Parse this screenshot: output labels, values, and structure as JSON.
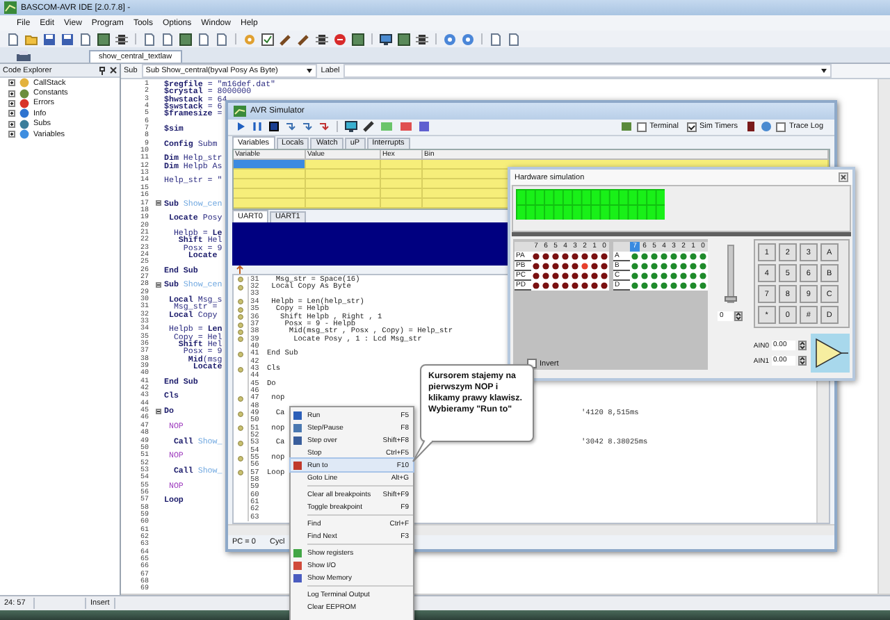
{
  "window": {
    "title": "BASCOM-AVR IDE [2.0.7.8] -"
  },
  "menu": [
    "File",
    "Edit",
    "View",
    "Program",
    "Tools",
    "Options",
    "Window",
    "Help"
  ],
  "file_tab": {
    "label": "show_central_textlaw",
    "selected": true
  },
  "code_explorer": {
    "title": "Code Explorer",
    "items": [
      {
        "label": "CallStack",
        "expanded": false
      },
      {
        "label": "Constants",
        "expanded": false
      },
      {
        "label": "Errors",
        "expanded": false
      },
      {
        "label": "Info",
        "expanded": false
      },
      {
        "label": "Subs",
        "expanded": false
      },
      {
        "label": "Variables",
        "expanded": false
      }
    ]
  },
  "editor": {
    "scope_label": "Sub",
    "scope_value": "Sub Show_central(byval Posy As Byte)",
    "label_label": "Label",
    "lines": [
      {
        "n": "1",
        "parts": [
          {
            "t": "$regfile",
            "kind": "kw"
          },
          {
            "t": " = \"m16def.dat\"",
            "kind": "txt"
          }
        ]
      },
      {
        "n": "2",
        "parts": [
          {
            "t": "$crystal",
            "kind": "kw"
          },
          {
            "t": " = 8000000",
            "kind": "txt"
          }
        ]
      },
      {
        "n": "3",
        "parts": [
          {
            "t": "$hwstack",
            "kind": "kw"
          },
          {
            "t": " = 64",
            "kind": "txt"
          }
        ]
      },
      {
        "n": "4",
        "parts": [
          {
            "t": "$swstack",
            "kind": "kw"
          },
          {
            "t": " = 6",
            "kind": "txt"
          }
        ]
      },
      {
        "n": "5",
        "parts": [
          {
            "t": "$framesize",
            "kind": "kw"
          },
          {
            "t": " =",
            "kind": "txt"
          }
        ]
      },
      {
        "n": "6"
      },
      {
        "n": "7",
        "parts": [
          {
            "t": "$sim",
            "kind": "kw"
          }
        ]
      },
      {
        "n": "8"
      },
      {
        "n": "9",
        "parts": [
          {
            "t": "Config",
            "kind": "kw"
          },
          {
            "t": " Subm",
            "kind": "txt"
          }
        ]
      },
      {
        "n": "10"
      },
      {
        "n": "11",
        "parts": [
          {
            "t": "Dim",
            "kind": "kw"
          },
          {
            "t": " Help_str",
            "kind": "txt"
          }
        ]
      },
      {
        "n": "12",
        "parts": [
          {
            "t": "Dim",
            "kind": "kw"
          },
          {
            "t": " Helpb As",
            "kind": "txt"
          }
        ]
      },
      {
        "n": "13"
      },
      {
        "n": "14",
        "parts": [
          {
            "t": "Help_str = \"",
            "kind": "txt"
          }
        ]
      },
      {
        "n": "15"
      },
      {
        "n": "16"
      },
      {
        "n": "17",
        "fold": true,
        "parts": [
          {
            "t": "Sub",
            "kind": "kw"
          },
          {
            "t": " Show_cen",
            "kind": "name"
          }
        ]
      },
      {
        "n": "18"
      },
      {
        "n": "19",
        "parts": [
          {
            "t": " Locate",
            "kind": "kw"
          },
          {
            "t": " Posy",
            "kind": "txt"
          }
        ]
      },
      {
        "n": "20"
      },
      {
        "n": "21",
        "parts": [
          {
            "t": "  Helpb = ",
            "kind": "txt"
          },
          {
            "t": "Le",
            "kind": "kw"
          }
        ]
      },
      {
        "n": "22",
        "parts": [
          {
            "t": "   Shift",
            "kind": "kw"
          },
          {
            "t": " Hel",
            "kind": "txt"
          }
        ]
      },
      {
        "n": "23",
        "parts": [
          {
            "t": "    Posx = 9",
            "kind": "txt"
          }
        ]
      },
      {
        "n": "24",
        "parts": [
          {
            "t": "     Locate",
            "kind": "kw"
          }
        ]
      },
      {
        "n": "25"
      },
      {
        "n": "26",
        "parts": [
          {
            "t": "End Sub",
            "kind": "kw"
          }
        ]
      },
      {
        "n": "27"
      },
      {
        "n": "28",
        "fold": true,
        "parts": [
          {
            "t": "Sub",
            "kind": "kw"
          },
          {
            "t": " Show_cen",
            "kind": "name"
          }
        ]
      },
      {
        "n": "29"
      },
      {
        "n": "30",
        "parts": [
          {
            "t": " Local",
            "kind": "kw"
          },
          {
            "t": " Msg_s",
            "kind": "txt"
          }
        ]
      },
      {
        "n": "31",
        "parts": [
          {
            "t": "  Msg_str =",
            "kind": "txt"
          }
        ]
      },
      {
        "n": "32",
        "parts": [
          {
            "t": " Local",
            "kind": "kw"
          },
          {
            "t": " Copy",
            "kind": "txt"
          }
        ]
      },
      {
        "n": "33"
      },
      {
        "n": "34",
        "parts": [
          {
            "t": " Helpb = ",
            "kind": "txt"
          },
          {
            "t": "Len",
            "kind": "kw"
          }
        ]
      },
      {
        "n": "35",
        "parts": [
          {
            "t": "  Copy = Hel",
            "kind": "txt"
          }
        ]
      },
      {
        "n": "36",
        "parts": [
          {
            "t": "   Shift",
            "kind": "kw"
          },
          {
            "t": " Hel",
            "kind": "txt"
          }
        ]
      },
      {
        "n": "37",
        "parts": [
          {
            "t": "    Posx = 9",
            "kind": "txt"
          }
        ]
      },
      {
        "n": "38",
        "parts": [
          {
            "t": "     Mid",
            "kind": "kw"
          },
          {
            "t": "(msg",
            "kind": "txt"
          }
        ]
      },
      {
        "n": "39",
        "parts": [
          {
            "t": "      Locate",
            "kind": "kw"
          }
        ]
      },
      {
        "n": "40"
      },
      {
        "n": "41",
        "parts": [
          {
            "t": "End Sub",
            "kind": "kw"
          }
        ]
      },
      {
        "n": "42"
      },
      {
        "n": "43",
        "parts": [
          {
            "t": "Cls",
            "kind": "kw"
          }
        ]
      },
      {
        "n": "44"
      },
      {
        "n": "45",
        "fold": true,
        "parts": [
          {
            "t": "Do",
            "kind": "kw"
          }
        ]
      },
      {
        "n": "46"
      },
      {
        "n": "47",
        "parts": [
          {
            "t": " NOP",
            "kind": "nop"
          }
        ]
      },
      {
        "n": "48"
      },
      {
        "n": "49",
        "parts": [
          {
            "t": "  Call",
            "kind": "kw"
          },
          {
            "t": " Show_",
            "kind": "name"
          }
        ]
      },
      {
        "n": "50"
      },
      {
        "n": "51",
        "parts": [
          {
            "t": " NOP",
            "kind": "nop"
          }
        ]
      },
      {
        "n": "52"
      },
      {
        "n": "53",
        "parts": [
          {
            "t": "  Call",
            "kind": "kw"
          },
          {
            "t": " Show_",
            "kind": "name"
          }
        ]
      },
      {
        "n": "54"
      },
      {
        "n": "55",
        "parts": [
          {
            "t": " NOP",
            "kind": "nop"
          }
        ]
      },
      {
        "n": "56"
      },
      {
        "n": "57",
        "parts": [
          {
            "t": "Loop",
            "kind": "kw"
          }
        ]
      },
      {
        "n": "58"
      },
      {
        "n": "59"
      },
      {
        "n": "60"
      },
      {
        "n": "61"
      },
      {
        "n": "62"
      },
      {
        "n": "63"
      },
      {
        "n": "64"
      },
      {
        "n": "65"
      },
      {
        "n": "66"
      },
      {
        "n": "67"
      },
      {
        "n": "68"
      },
      {
        "n": "69"
      }
    ]
  },
  "status_bar": [
    "24: 57",
    "Insert"
  ],
  "simulator": {
    "title": "AVR Simulator",
    "checkboxes": [
      {
        "label": "Terminal",
        "checked": false
      },
      {
        "label": "Sim Timers",
        "checked": true
      },
      {
        "label": "Trace Log",
        "checked": false
      }
    ],
    "tabs": [
      {
        "label": "Variables",
        "selected": true
      },
      {
        "label": "Locals",
        "selected": false
      },
      {
        "label": "Watch",
        "selected": false
      },
      {
        "label": "uP",
        "selected": false
      },
      {
        "label": "Interrupts",
        "selected": false
      }
    ],
    "columns": [
      "Variable",
      "Value",
      "Hex",
      "Bin"
    ],
    "rows": [
      {
        "selected": true
      },
      {
        "selected": false
      },
      {
        "selected": false
      },
      {
        "selected": false
      },
      {
        "selected": false
      }
    ],
    "uart_tabs": [
      {
        "label": "UART0",
        "selected": true
      },
      {
        "label": "UART1",
        "selected": false
      }
    ],
    "lines": [
      {
        "n": "31",
        "dot": true,
        "text": "  Msg_str = Space(16)"
      },
      {
        "n": "32",
        "dot": true,
        "text": " Local Copy As Byte"
      },
      {
        "n": "33",
        "dot": false
      },
      {
        "n": "34",
        "dot": true,
        "text": " Helpb = Len(help_str)"
      },
      {
        "n": "35",
        "dot": true,
        "text": "  Copy = Helpb"
      },
      {
        "n": "36",
        "dot": true,
        "text": "   Shift Helpb , Right , 1"
      },
      {
        "n": "37",
        "dot": true,
        "text": "    Posx = 9 - Helpb"
      },
      {
        "n": "38",
        "dot": true,
        "text": "     Mid(msg_str , Posx , Copy) = Help_str"
      },
      {
        "n": "39",
        "dot": true,
        "text": "      Locate Posy , 1 : Lcd Msg_str"
      },
      {
        "n": "40",
        "dot": false
      },
      {
        "n": "41",
        "dot": true,
        "text": "End Sub"
      },
      {
        "n": "42",
        "dot": false
      },
      {
        "n": "43",
        "dot": true,
        "text": "Cls"
      },
      {
        "n": "44",
        "dot": false
      },
      {
        "n": "45",
        "dot": false,
        "text": "Do"
      },
      {
        "n": "46",
        "dot": false
      },
      {
        "n": "47",
        "dot": true,
        "text": " nop"
      },
      {
        "n": "48",
        "dot": false
      },
      {
        "n": "49",
        "dot": true,
        "text": "  Ca",
        "comment": "'4120 8,515ms"
      },
      {
        "n": "50",
        "dot": false
      },
      {
        "n": "51",
        "dot": true,
        "text": " nop"
      },
      {
        "n": "52",
        "dot": false
      },
      {
        "n": "53",
        "dot": true,
        "text": "  Ca",
        "comment": "'3042 8.38025ms"
      },
      {
        "n": "54",
        "dot": false
      },
      {
        "n": "55",
        "dot": true,
        "text": " nop"
      },
      {
        "n": "56",
        "dot": false
      },
      {
        "n": "57",
        "dot": true,
        "text": "Loop"
      },
      {
        "n": "58",
        "dot": false
      },
      {
        "n": "59",
        "dot": false
      },
      {
        "n": "60",
        "dot": false
      },
      {
        "n": "61",
        "dot": false
      },
      {
        "n": "62",
        "dot": false
      },
      {
        "n": "63",
        "dot": false
      }
    ],
    "status": [
      "PC = 0",
      "Cycl"
    ]
  },
  "hardware": {
    "title": "Hardware simulation",
    "bits": [
      "7",
      "6",
      "5",
      "4",
      "3",
      "2",
      "1",
      "0"
    ],
    "ports": [
      {
        "label": "PA",
        "leds": [
          false,
          false,
          false,
          false,
          false,
          false,
          false,
          false
        ]
      },
      {
        "label": "PB",
        "leds": [
          false,
          false,
          false,
          false,
          false,
          true,
          false,
          false
        ]
      },
      {
        "label": "PC",
        "leds": [
          false,
          false,
          false,
          false,
          false,
          false,
          false,
          false
        ]
      },
      {
        "label": "PD",
        "leds": [
          false,
          false,
          false,
          false,
          false,
          false,
          false,
          false
        ]
      }
    ],
    "pin_bits": [
      {
        "label": "7",
        "selected": true
      },
      {
        "label": "6",
        "selected": false
      },
      {
        "label": "5",
        "selected": false
      },
      {
        "label": "4",
        "selected": false
      },
      {
        "label": "3",
        "selected": false
      },
      {
        "label": "2",
        "selected": false
      },
      {
        "label": "1",
        "selected": false
      },
      {
        "label": "0",
        "selected": false
      }
    ],
    "pins": [
      "A",
      "B",
      "C",
      "D"
    ],
    "slider": {
      "level": 0,
      "value": "0"
    },
    "keys": [
      "1",
      "2",
      "3",
      "A",
      "4",
      "5",
      "6",
      "B",
      "7",
      "8",
      "9",
      "C",
      "*",
      "0",
      "#",
      "D"
    ],
    "analog": [
      {
        "label": "AIN0",
        "value": "0.00"
      },
      {
        "label": "AIN1",
        "value": "0.00"
      }
    ],
    "invert": {
      "label": "Invert",
      "checked": false
    }
  },
  "context_menu": [
    {
      "kind": "item",
      "label": "Run",
      "shortcut": "F5",
      "icon": true,
      "selected": false
    },
    {
      "kind": "item",
      "label": "Step/Pause",
      "shortcut": "F8",
      "icon": true,
      "selected": false
    },
    {
      "kind": "item",
      "label": "Step over",
      "shortcut": "Shift+F8",
      "icon": true,
      "selected": false
    },
    {
      "kind": "item",
      "label": "Stop",
      "shortcut": "Ctrl+F5",
      "icon": false,
      "selected": false
    },
    {
      "kind": "item",
      "label": "Run to",
      "shortcut": "F10",
      "icon": true,
      "selected": true
    },
    {
      "kind": "item",
      "label": "Goto Line",
      "shortcut": "Alt+G",
      "icon": false,
      "selected": false
    },
    {
      "kind": "separator"
    },
    {
      "kind": "item",
      "label": "Clear all breakpoints",
      "shortcut": "Shift+F9",
      "icon": false,
      "selected": false
    },
    {
      "kind": "item",
      "label": "Toggle breakpoint",
      "shortcut": "F9",
      "icon": false,
      "selected": false
    },
    {
      "kind": "separator"
    },
    {
      "kind": "item",
      "label": "Find",
      "shortcut": "Ctrl+F",
      "icon": false,
      "selected": false
    },
    {
      "kind": "item",
      "label": "Find Next",
      "shortcut": "F3",
      "icon": false,
      "selected": false
    },
    {
      "kind": "separator"
    },
    {
      "kind": "item",
      "label": "Show registers",
      "icon": true,
      "selected": false
    },
    {
      "kind": "item",
      "label": "Show I/O",
      "icon": true,
      "selected": false
    },
    {
      "kind": "item",
      "label": "Show Memory",
      "icon": true,
      "selected": false
    },
    {
      "kind": "separator"
    },
    {
      "kind": "item",
      "label": "Log Terminal Output",
      "icon": false,
      "selected": false
    },
    {
      "kind": "item",
      "label": "Clear EEPROM",
      "icon": false,
      "selected": false
    }
  ],
  "callout": {
    "text": "Kursorem stajemy na pierwszym NOP i klikamy prawy klawisz. Wybieramy \"Run to\""
  }
}
